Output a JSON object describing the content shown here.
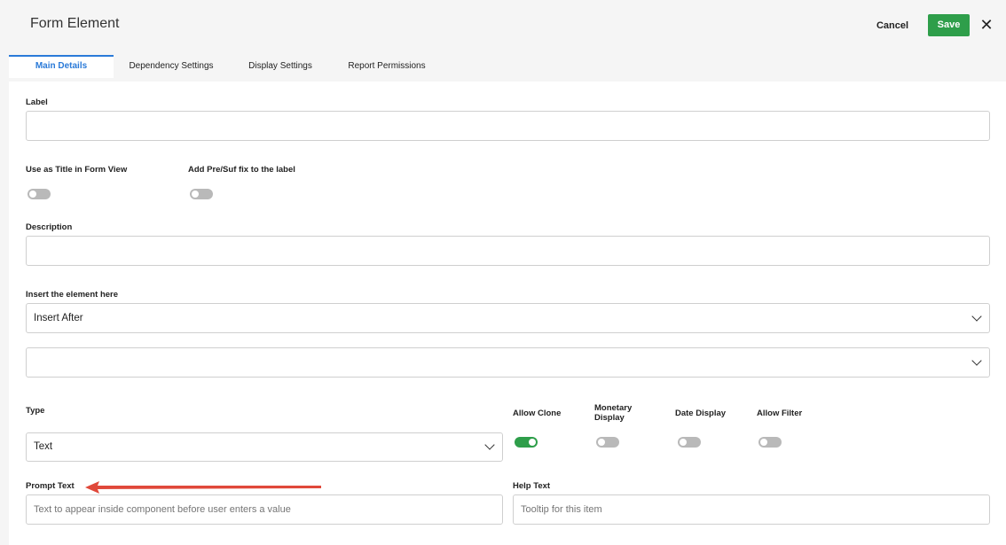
{
  "header": {
    "title": "Form Element",
    "cancel_label": "Cancel",
    "save_label": "Save",
    "close_glyph": "✕"
  },
  "tabs": [
    {
      "label": "Main Details",
      "active": true
    },
    {
      "label": "Dependency Settings",
      "active": false
    },
    {
      "label": "Display Settings",
      "active": false
    },
    {
      "label": "Report Permissions",
      "active": false
    }
  ],
  "form": {
    "label_field": {
      "label": "Label",
      "value": ""
    },
    "use_as_title": {
      "label": "Use as Title in Form View",
      "on": false
    },
    "add_prefix_suffix": {
      "label": "Add Pre/Suf fix to the label",
      "on": false
    },
    "description": {
      "label": "Description",
      "value": ""
    },
    "insert_element": {
      "label": "Insert the element here",
      "value": "Insert After"
    },
    "insert_target": {
      "value": ""
    },
    "type": {
      "label": "Type",
      "value": "Text"
    },
    "allow_clone": {
      "label": "Allow Clone",
      "on": true
    },
    "monetary_display": {
      "label": "Monetary Display",
      "on": false
    },
    "date_display": {
      "label": "Date Display",
      "on": false
    },
    "allow_filter": {
      "label": "Allow Filter",
      "on": false
    },
    "prompt_text": {
      "label": "Prompt Text",
      "placeholder": "Text to appear inside component before user enters a value"
    },
    "help_text": {
      "label": "Help Text",
      "placeholder": "Tooltip for this item"
    }
  },
  "colors": {
    "accent": "#2a7ad8",
    "save_green": "#2e9e4a",
    "annotation_arrow": "#e0483a"
  }
}
